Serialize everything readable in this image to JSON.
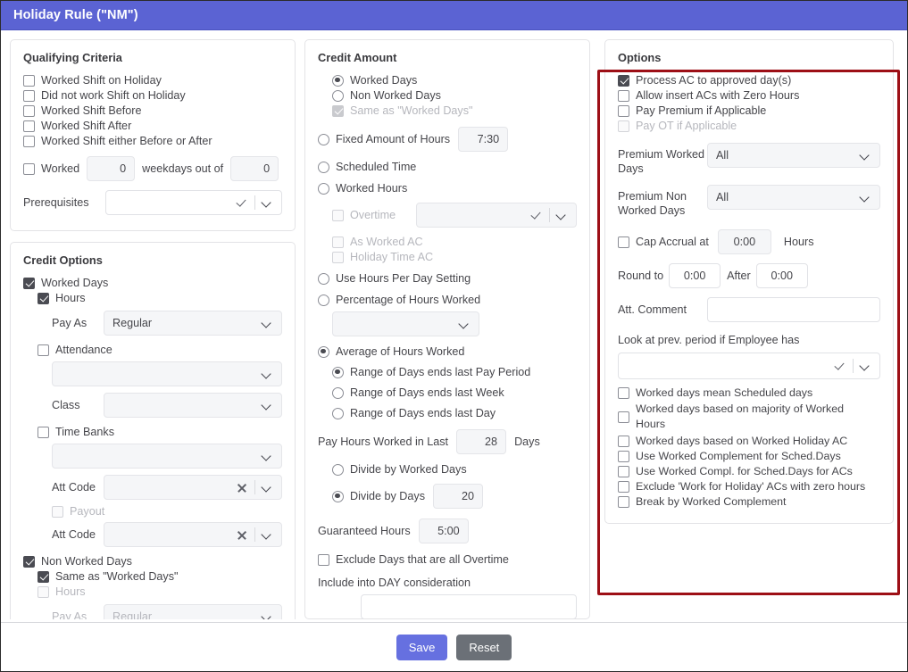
{
  "window": {
    "title": "Holiday Rule (\"NM\")",
    "header_color": "#5b63d3"
  },
  "highlight": {
    "color": "#9d0f16"
  },
  "qualifying_criteria": {
    "title": "Qualifying Criteria",
    "checks": [
      {
        "label": "Worked Shift on Holiday",
        "checked": false
      },
      {
        "label": "Did not work Shift on Holiday",
        "checked": false
      },
      {
        "label": "Worked Shift Before",
        "checked": false
      },
      {
        "label": "Worked Shift After",
        "checked": false
      },
      {
        "label": "Worked Shift either Before or After",
        "checked": false
      }
    ],
    "worked_row": {
      "label": "Worked",
      "checked": false,
      "count": "0",
      "mid_label": "weekdays out of",
      "out_of": "0"
    },
    "prerequisites": {
      "label": "Prerequisites",
      "value": ""
    }
  },
  "credit_options": {
    "title": "Credit Options",
    "worked_days": {
      "label": "Worked Days",
      "checked": true
    },
    "hours": {
      "label": "Hours",
      "checked": true
    },
    "pay_as": {
      "label": "Pay As",
      "value": "Regular"
    },
    "attendance": {
      "label": "Attendance",
      "checked": false,
      "value": ""
    },
    "class": {
      "label": "Class",
      "value": ""
    },
    "time_banks": {
      "label": "Time Banks",
      "checked": false,
      "value": ""
    },
    "att_code_1": {
      "label": "Att Code",
      "value": ""
    },
    "payout": {
      "label": "Payout",
      "checked": false
    },
    "att_code_2": {
      "label": "Att Code",
      "value": ""
    },
    "non_worked_days": {
      "label": "Non Worked Days",
      "checked": true
    },
    "same_as_worked_days": {
      "label": "Same as \"Worked Days\"",
      "checked": true
    },
    "nwd_hours": {
      "label": "Hours",
      "checked": false
    },
    "nwd_pay_as": {
      "label": "Pay As",
      "value": "Regular"
    }
  },
  "credit_amount": {
    "title": "Credit Amount",
    "radios_top": [
      {
        "label": "Worked Days",
        "selected": true
      },
      {
        "label": "Non Worked Days",
        "selected": false
      }
    ],
    "same_as_worked_days": {
      "label": "Same as \"Worked Days\"",
      "checked": true,
      "disabled": true
    },
    "fixed_amount": {
      "label": "Fixed Amount of Hours",
      "selected": false,
      "value": "7:30"
    },
    "scheduled_time": {
      "label": "Scheduled Time",
      "selected": false
    },
    "worked_hours": {
      "label": "Worked Hours",
      "selected": false
    },
    "overtime": {
      "label": "Overtime",
      "checked": false,
      "value": ""
    },
    "as_worked_ac": {
      "label": "As Worked AC",
      "checked": false
    },
    "holiday_time_ac": {
      "label": "Holiday Time AC",
      "checked": false
    },
    "use_hours_per_day": {
      "label": "Use Hours Per Day Setting",
      "selected": false
    },
    "percentage": {
      "label": "Percentage of Hours Worked",
      "selected": false,
      "value": ""
    },
    "average": {
      "label": "Average of Hours Worked",
      "selected": true
    },
    "range_options": [
      {
        "label": "Range of Days ends last Pay Period",
        "selected": true
      },
      {
        "label": "Range of Days ends last Week",
        "selected": false
      },
      {
        "label": "Range of Days ends last Day",
        "selected": false
      }
    ],
    "pay_hours_last": {
      "label": "Pay Hours Worked in Last",
      "value": "28",
      "suffix": "Days"
    },
    "divide_by_worked_days": {
      "label": "Divide by Worked Days",
      "selected": false
    },
    "divide_by_days": {
      "label": "Divide by Days",
      "selected": true,
      "value": "20"
    },
    "guaranteed_hours": {
      "label": "Guaranteed Hours",
      "value": "5:00"
    },
    "exclude_overtime": {
      "label": "Exclude Days that are all Overtime",
      "checked": false
    },
    "include_day_consideration": {
      "label": "Include into DAY consideration",
      "value": ""
    }
  },
  "options": {
    "title": "Options",
    "checks_top": [
      {
        "label": "Process AC to approved day(s)",
        "checked": true,
        "disabled": false
      },
      {
        "label": "Allow insert ACs with Zero Hours",
        "checked": false,
        "disabled": false
      },
      {
        "label": "Pay Premium if Applicable",
        "checked": false,
        "disabled": false
      },
      {
        "label": "Pay OT if Applicable",
        "checked": false,
        "disabled": true
      }
    ],
    "premium_worked_days": {
      "label": "Premium Worked Days",
      "value": "All"
    },
    "premium_non_worked_days": {
      "label": "Premium Non Worked Days",
      "value": "All"
    },
    "cap_accrual": {
      "label": "Cap Accrual at",
      "checked": false,
      "value": "0:00",
      "suffix": "Hours"
    },
    "round_to": {
      "label": "Round to",
      "value": "0:00",
      "after_label": "After",
      "after_value": "0:00"
    },
    "att_comment": {
      "label": "Att. Comment",
      "value": ""
    },
    "look_at_prev": {
      "label": "Look at prev. period if Employee has",
      "value": ""
    },
    "checks_bottom": [
      {
        "label": "Worked days mean Scheduled days",
        "checked": false
      },
      {
        "label": "Worked days based on majority of Worked Hours",
        "checked": false
      },
      {
        "label": "Worked days based on Worked Holiday AC",
        "checked": false
      },
      {
        "label": "Use Worked Complement for Sched.Days",
        "checked": false
      },
      {
        "label": "Use Worked Compl. for Sched.Days for ACs",
        "checked": false
      },
      {
        "label": "Exclude 'Work for Holiday' ACs with zero hours",
        "checked": false
      },
      {
        "label": "Break by Worked Complement",
        "checked": false
      }
    ]
  },
  "footer": {
    "save_label": "Save",
    "reset_label": "Reset"
  }
}
